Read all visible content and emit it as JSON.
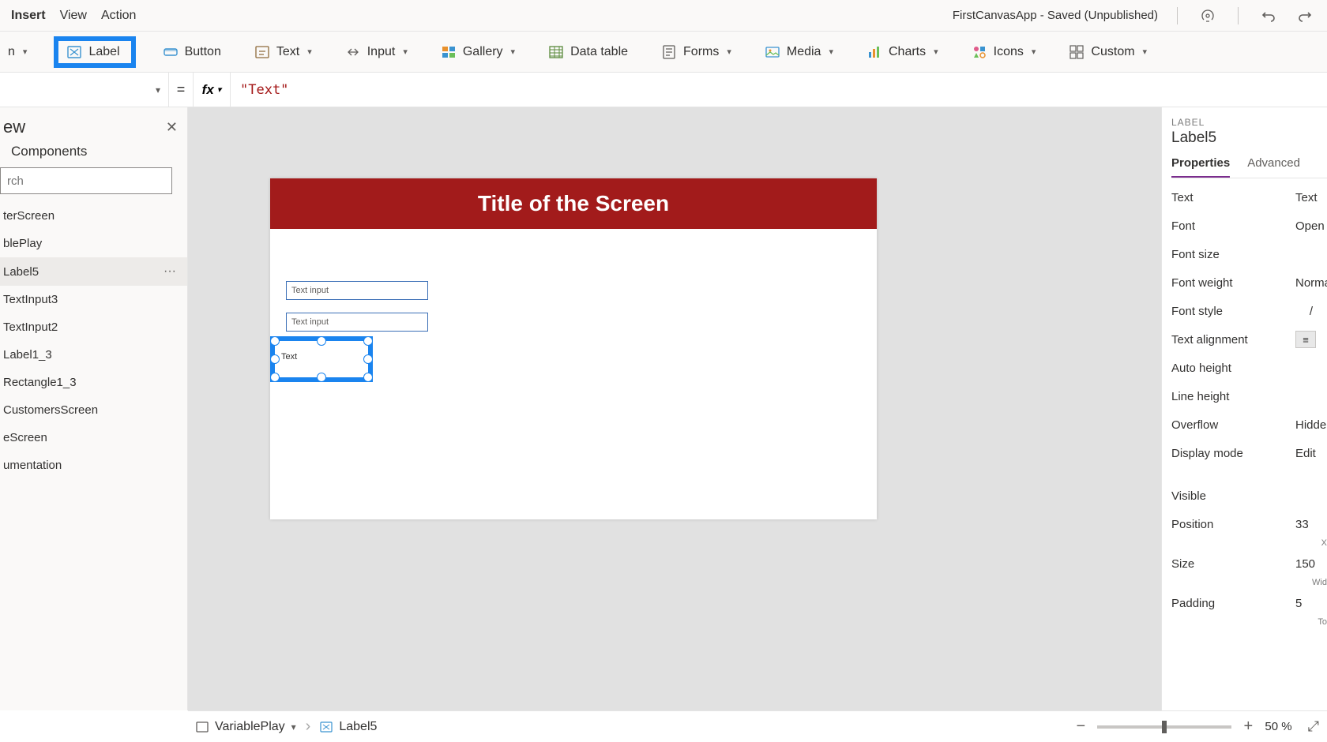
{
  "menu": {
    "items": [
      "Insert",
      "View",
      "Action"
    ],
    "status": "FirstCanvasApp - Saved (Unpublished)"
  },
  "ribbon": {
    "first_caret_frag": "n",
    "label": "Label",
    "button": "Button",
    "text": "Text",
    "input": "Input",
    "gallery": "Gallery",
    "datatable": "Data table",
    "forms": "Forms",
    "media": "Media",
    "charts": "Charts",
    "icons": "Icons",
    "custom": "Custom"
  },
  "formula": {
    "prop_selected": "",
    "fx": "fx",
    "equals": "=",
    "value": "\"Text\""
  },
  "tree": {
    "title_frag": "ew",
    "tab": "Components",
    "search_placeholder": "rch",
    "items": [
      "terScreen",
      "blePlay",
      "Label5",
      "TextInput3",
      "TextInput2",
      "Label1_3",
      "Rectangle1_3",
      "CustomersScreen",
      "eScreen",
      "umentation"
    ],
    "selected_index": 2
  },
  "canvas": {
    "screen_title": "Title of the Screen",
    "textinput1": "Text input",
    "textinput2": "Text input",
    "selected_label_text": "Text"
  },
  "props": {
    "kind": "LABEL",
    "obj": "Label5",
    "tabs": [
      "Properties",
      "Advanced"
    ],
    "rows": {
      "text": {
        "k": "Text",
        "v": "Text"
      },
      "font": {
        "k": "Font",
        "v": "Open S"
      },
      "font_size": {
        "k": "Font size",
        "v": ""
      },
      "font_weight": {
        "k": "Font weight",
        "v": "Norma"
      },
      "font_style": {
        "k": "Font style",
        "v": "/"
      },
      "text_align": {
        "k": "Text alignment",
        "v": "≡"
      },
      "auto_height": {
        "k": "Auto height",
        "v": ""
      },
      "line_height": {
        "k": "Line height",
        "v": ""
      },
      "overflow": {
        "k": "Overflow",
        "v": "Hidden"
      },
      "display_mode": {
        "k": "Display mode",
        "v": "Edit"
      },
      "visible": {
        "k": "Visible",
        "v": ""
      },
      "position": {
        "k": "Position",
        "v": "33"
      },
      "position_sub": "X",
      "size": {
        "k": "Size",
        "v": "150"
      },
      "size_sub": "Wid",
      "padding": {
        "k": "Padding",
        "v": "5"
      },
      "padding_sub": "To"
    }
  },
  "statusbar": {
    "screen": "VariablePlay",
    "control": "Label5",
    "zoom": "50  %"
  },
  "icons": {
    "label": "label-icon",
    "button": "button-icon",
    "text": "text-icon",
    "input": "input-icon",
    "gallery": "gallery-icon",
    "datatable": "datatable-icon",
    "forms": "forms-icon",
    "media": "media-icon",
    "charts": "charts-icon",
    "icons": "icons-icon",
    "custom": "custom-icon",
    "health": "health-icon",
    "undo": "undo-icon",
    "redo": "redo-icon",
    "rect": "rect-icon",
    "fit": "fit-icon"
  }
}
